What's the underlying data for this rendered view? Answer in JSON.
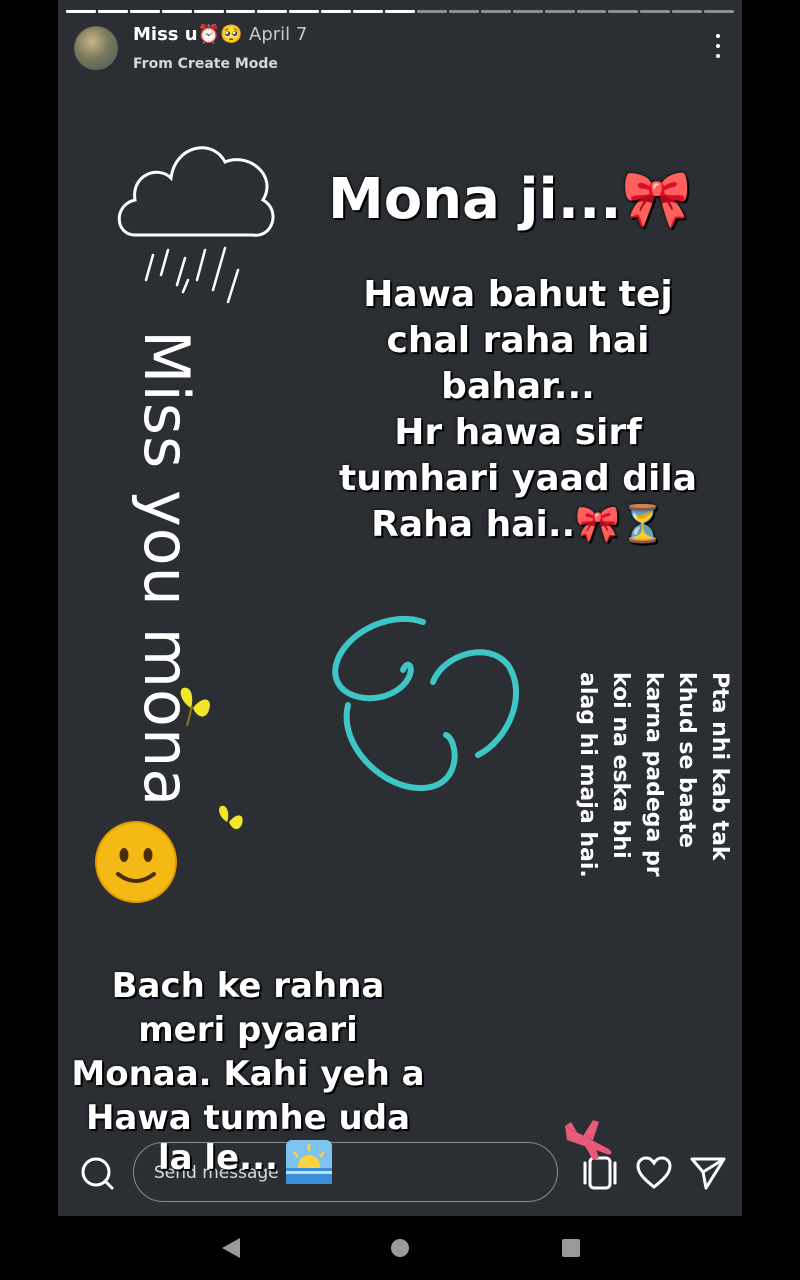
{
  "story": {
    "username": "Miss u⏰🥺",
    "date": "April 7",
    "subtitle": "From Create Mode",
    "segments_total": 21,
    "segments_done": 11
  },
  "content": {
    "title": "Mona ji...🎀",
    "main_lines": [
      "Hawa bahut tej",
      "chal raha hai",
      "bahar...",
      "Hr hawa sirf",
      "tumhari yaad dila",
      "Raha hai..🎀⏳"
    ],
    "vertical_left": "Miss you mona",
    "vertical_right_lines": [
      "Pta nhi kab tak",
      "khud se baate",
      "karna padega pr",
      "koi na eska bhi",
      "alag hi maja hai."
    ],
    "bottom_lines": [
      "Bach ke rahna",
      "meri pyaari",
      "Monaa. Kahi yeh a",
      "Hawa tumhe uda"
    ],
    "overlay_line": "la le..."
  },
  "composer": {
    "placeholder": "Send message"
  },
  "colors": {
    "background": "#2b2e33",
    "swirl": "#3ec6c6",
    "butterfly": "#f2e629",
    "bow": "#e0303a"
  },
  "icons": [
    "search-icon",
    "more-icon",
    "reels-icon",
    "heart-icon",
    "send-icon",
    "back-icon",
    "home-icon",
    "recents-icon"
  ]
}
